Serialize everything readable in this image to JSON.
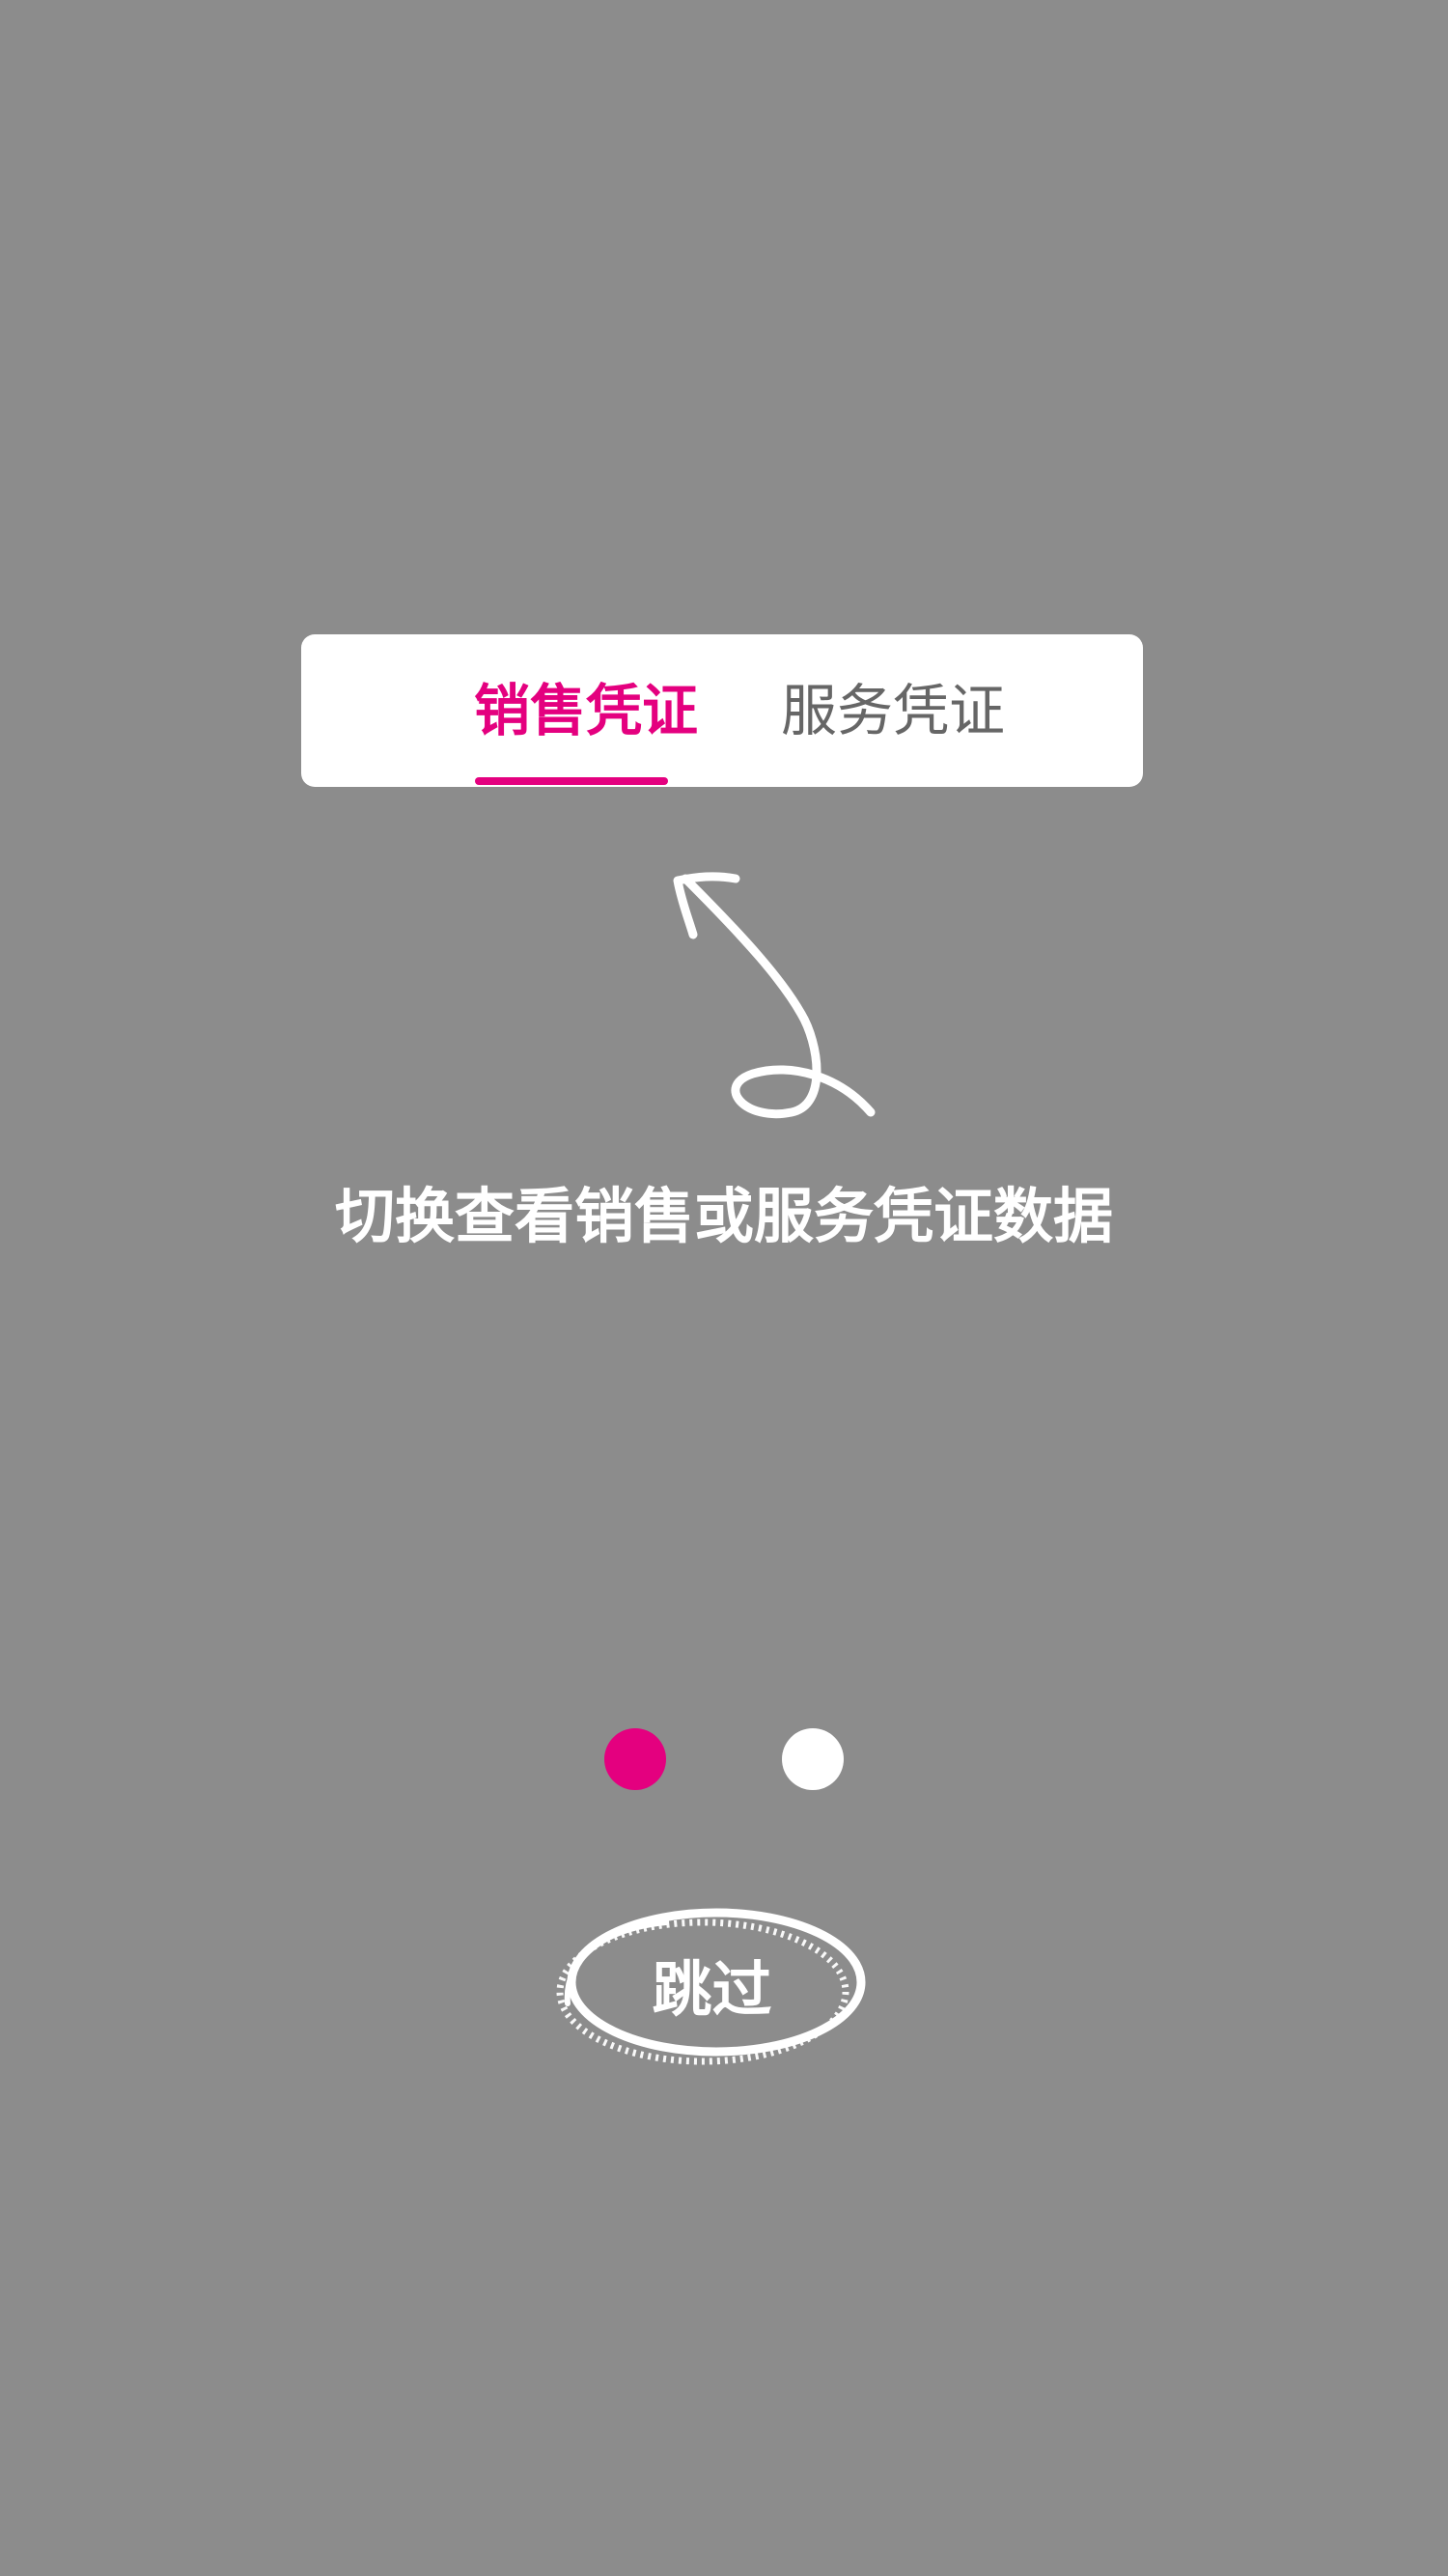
{
  "tabs": [
    {
      "label": "销售凭证",
      "active": true
    },
    {
      "label": "服务凭证",
      "active": false
    }
  ],
  "hint": {
    "text": "切换查看销售或服务凭证数据"
  },
  "pager": {
    "total": 2,
    "current": 1
  },
  "skip": {
    "label": "跳过"
  },
  "colors": {
    "overlay": "#8c8c8c",
    "accent": "#e4007f",
    "inactive_tab": "#666666",
    "card": "#ffffff"
  },
  "icons": [
    "hand-drawn-arrow-icon",
    "hand-drawn-oval-icon"
  ]
}
